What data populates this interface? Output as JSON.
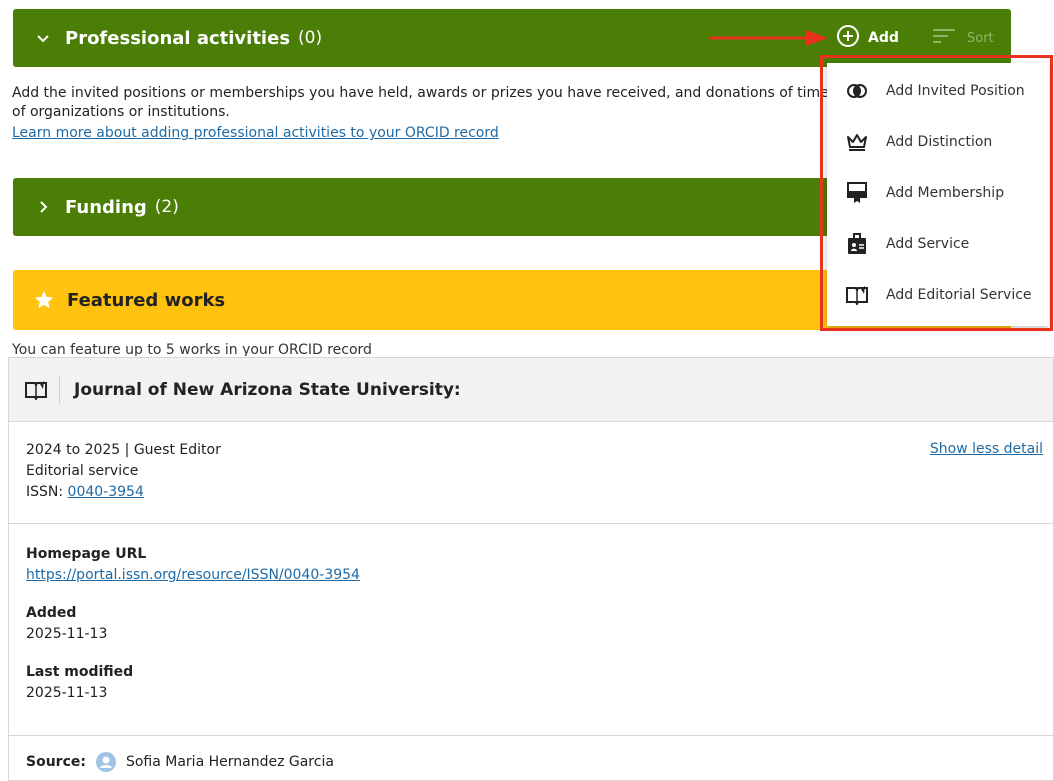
{
  "professional": {
    "title": "Professional activities",
    "count": "(0)",
    "add_label": "Add",
    "sort_label": "Sort",
    "description": "Add the invited positions or memberships you have held, awards or prizes you have received, and donations of time or resources in service of organizations or institutions.",
    "learn_more": "Learn more about adding professional activities to your ORCID record"
  },
  "funding": {
    "title": "Funding",
    "count": "(2)"
  },
  "featured": {
    "title": "Featured works",
    "subtitle": "You can feature up to 5 works in your ORCID record"
  },
  "menu": {
    "items": [
      {
        "label": "Add Invited Position",
        "icon": "overlap-circles-icon"
      },
      {
        "label": "Add Distinction",
        "icon": "crown-icon"
      },
      {
        "label": "Add Membership",
        "icon": "membership-card-icon"
      },
      {
        "label": "Add Service",
        "icon": "id-badge-icon"
      },
      {
        "label": "Add Editorial Service",
        "icon": "open-book-icon"
      }
    ]
  },
  "card": {
    "title": "Journal of New Arizona State University:",
    "dates_role": "2024 to 2025 | Guest Editor",
    "type": "Editorial service",
    "issn_label": "ISSN: ",
    "issn_value": "0040-3954",
    "show_less": "Show less detail",
    "homepage_label": "Homepage URL",
    "homepage_url": "https://portal.issn.org/resource/ISSN/0040-3954",
    "added_label": "Added",
    "added_value": "2025-11-13",
    "modified_label": "Last modified",
    "modified_value": "2025-11-13",
    "source_label": "Source:",
    "source_value": "Sofia Maria Hernandez Garcia"
  },
  "colors": {
    "panel_green": "#4a7e06",
    "panel_yellow": "#ffc20e",
    "highlight_red": "#e8321c",
    "link_blue": "#1f6aa5"
  }
}
